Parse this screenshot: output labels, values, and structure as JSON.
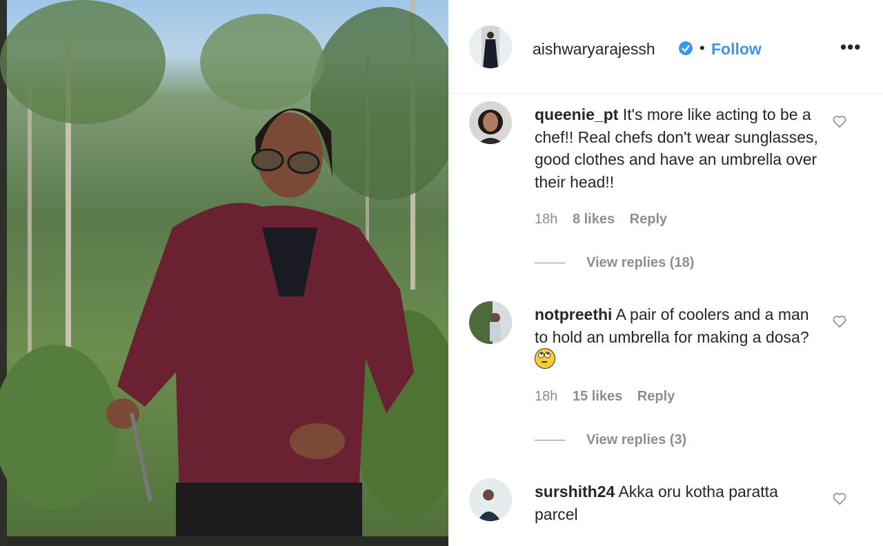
{
  "post": {
    "author": "aishwaryarajessh",
    "separator": "•",
    "follow_label": "Follow",
    "more_label": "•••"
  },
  "comments": [
    {
      "username": "queenie_pt",
      "text": "It's more like acting to be a chef!! Real chefs don't wear sunglasses, good clothes and have an umbrella over their head!!",
      "time": "18h",
      "likes": "8 likes",
      "reply": "Reply",
      "view_replies": "View replies (18)"
    },
    {
      "username": "notpreethi",
      "text": "A pair of coolers and a man to hold an umbrella for making a dosa?",
      "emoji": "rolling-eyes-emoji",
      "time": "18h",
      "likes": "15 likes",
      "reply": "Reply",
      "view_replies": "View replies (3)"
    },
    {
      "username": "surshith24",
      "text": "Akka oru kotha paratta parcel"
    }
  ],
  "colors": {
    "link": "#3897f0",
    "muted": "#8e8e8e",
    "text": "#262626"
  }
}
